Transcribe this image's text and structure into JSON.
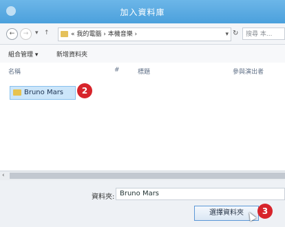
{
  "window": {
    "title": "加入資料庫"
  },
  "nav": {
    "back": "←",
    "forward": "→",
    "recent": "▾",
    "up": "↑",
    "breadcrumbs": "« 我的電腦 › 本機音樂 ›",
    "address_dropdown": "▾",
    "refresh": "↻",
    "search_placeholder": "搜尋 本..."
  },
  "toolbar": {
    "organize": "組合管理 ▾",
    "new_folder": "新增資料夾"
  },
  "columns": {
    "name": "名稱",
    "number": "#",
    "title": "標題",
    "artists": "參與演出者"
  },
  "files": [
    {
      "name": "Bruno Mars",
      "selected": true
    }
  ],
  "annotations": {
    "step2": "2",
    "step3": "3"
  },
  "folder_field": {
    "label": "資料夾:",
    "value": "Bruno Mars"
  },
  "actions": {
    "select_folder": "選擇資料夾"
  },
  "colors": {
    "titlebar": "#4ba0dc",
    "selection": "#cce6fa",
    "callout": "#d7242b",
    "folder": "#e7c34f"
  }
}
